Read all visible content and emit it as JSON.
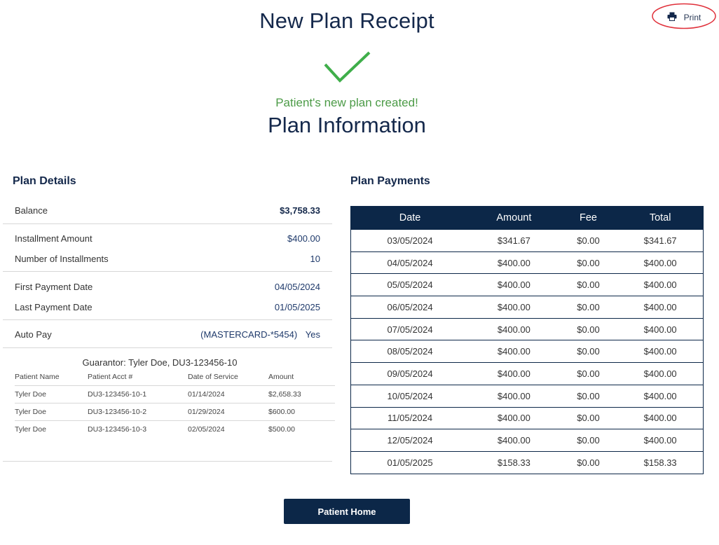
{
  "header": {
    "title": "New Plan Receipt",
    "print_label": "Print"
  },
  "status": {
    "success_message": "Patient's new plan created!",
    "section_title": "Plan Information"
  },
  "plan_details": {
    "heading": "Plan Details",
    "balance": {
      "label": "Balance",
      "value": "$3,758.33"
    },
    "installment_amount": {
      "label": "Installment Amount",
      "value": "$400.00"
    },
    "number_of_installments": {
      "label": "Number of Installments",
      "value": "10"
    },
    "first_payment_date": {
      "label": "First Payment Date",
      "value": "04/05/2024"
    },
    "last_payment_date": {
      "label": "Last Payment Date",
      "value": "01/05/2025"
    },
    "auto_pay": {
      "label": "Auto Pay",
      "card": "(MASTERCARD-*5454)",
      "value": "Yes"
    }
  },
  "guarantor": {
    "title": "Guarantor: Tyler Doe, DU3-123456-10",
    "columns": [
      "Patient Name",
      "Patient Acct #",
      "Date of Service",
      "Amount"
    ],
    "rows": [
      [
        "Tyler Doe",
        "DU3-123456-10-1",
        "01/14/2024",
        "$2,658.33"
      ],
      [
        "Tyler Doe",
        "DU3-123456-10-2",
        "01/29/2024",
        "$600.00"
      ],
      [
        "Tyler Doe",
        "DU3-123456-10-3",
        "02/05/2024",
        "$500.00"
      ]
    ]
  },
  "plan_payments": {
    "heading": "Plan Payments",
    "columns": [
      "Date",
      "Amount",
      "Fee",
      "Total"
    ],
    "rows": [
      [
        "03/05/2024",
        "$341.67",
        "$0.00",
        "$341.67"
      ],
      [
        "04/05/2024",
        "$400.00",
        "$0.00",
        "$400.00"
      ],
      [
        "05/05/2024",
        "$400.00",
        "$0.00",
        "$400.00"
      ],
      [
        "06/05/2024",
        "$400.00",
        "$0.00",
        "$400.00"
      ],
      [
        "07/05/2024",
        "$400.00",
        "$0.00",
        "$400.00"
      ],
      [
        "08/05/2024",
        "$400.00",
        "$0.00",
        "$400.00"
      ],
      [
        "09/05/2024",
        "$400.00",
        "$0.00",
        "$400.00"
      ],
      [
        "10/05/2024",
        "$400.00",
        "$0.00",
        "$400.00"
      ],
      [
        "11/05/2024",
        "$400.00",
        "$0.00",
        "$400.00"
      ],
      [
        "12/05/2024",
        "$400.00",
        "$0.00",
        "$400.00"
      ],
      [
        "01/05/2025",
        "$158.33",
        "$0.00",
        "$158.33"
      ]
    ]
  },
  "footer": {
    "home_button_label": "Patient Home"
  },
  "icons": {
    "print": "printer-icon",
    "success": "checkmark-icon"
  },
  "colors": {
    "brand_navy": "#0c2748",
    "success_green": "#4c9b47",
    "annotation_red": "#e0303a"
  }
}
